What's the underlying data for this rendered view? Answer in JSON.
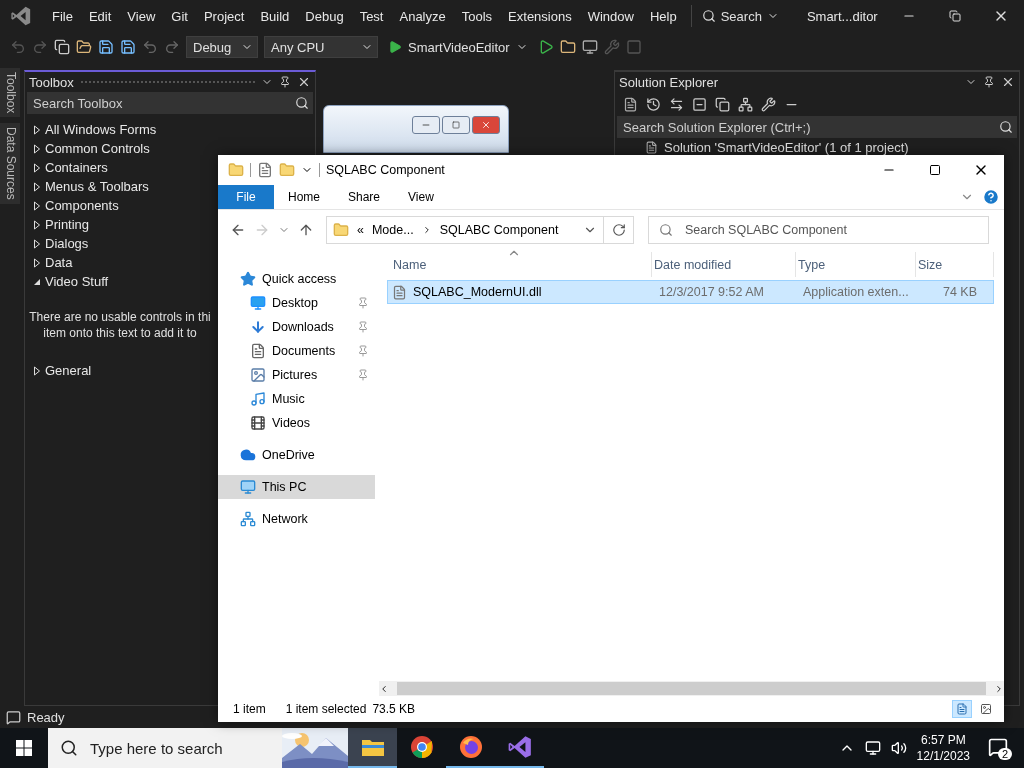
{
  "ide": {
    "menu": [
      "File",
      "Edit",
      "View",
      "Git",
      "Project",
      "Build",
      "Debug",
      "Test",
      "Analyze",
      "Tools",
      "Extensions",
      "Window",
      "Help"
    ],
    "search": "Search",
    "title": "Smart...ditor",
    "toolbar": {
      "configuration": "Debug",
      "platform": "Any CPU",
      "start_target": "SmartVideoEditor"
    },
    "side_tabs": [
      "Toolbox",
      "Data Sources"
    ],
    "toolbox": {
      "title": "Toolbox",
      "search_placeholder": "Search Toolbox",
      "groups": [
        {
          "label": "All Windows Forms",
          "expanded": false
        },
        {
          "label": "Common Controls",
          "expanded": false
        },
        {
          "label": "Containers",
          "expanded": false
        },
        {
          "label": "Menus & Toolbars",
          "expanded": false
        },
        {
          "label": "Components",
          "expanded": false
        },
        {
          "label": "Printing",
          "expanded": false
        },
        {
          "label": "Dialogs",
          "expanded": false
        },
        {
          "label": "Data",
          "expanded": false
        },
        {
          "label": "Video Stuff",
          "expanded": true,
          "empty_message": [
            "There are no usable controls in thi",
            "item onto this text to add it to"
          ]
        },
        {
          "label": "General",
          "expanded": false
        }
      ]
    },
    "solution_explorer": {
      "title": "Solution Explorer",
      "search_placeholder": "Search Solution Explorer (Ctrl+;)",
      "root": "Solution 'SmartVideoEditor' (1 of 1 project)"
    },
    "status": "Ready"
  },
  "explorer": {
    "title": "SQLABC Component",
    "ribbon_tabs": [
      {
        "label": "File",
        "selected": true
      },
      {
        "label": "Home",
        "selected": false
      },
      {
        "label": "Share",
        "selected": false
      },
      {
        "label": "View",
        "selected": false
      }
    ],
    "address": {
      "overflow": "«",
      "crumbs": [
        "Mode...",
        "SQLABC Component"
      ]
    },
    "search_placeholder": "Search SQLABC Component",
    "nav": [
      {
        "label": "Quick access",
        "kind": "quick_access",
        "selected": false,
        "children": [
          {
            "label": "Desktop",
            "kind": "desktop",
            "selected": false,
            "pinned": true
          },
          {
            "label": "Downloads",
            "kind": "downloads",
            "selected": false,
            "pinned": true
          },
          {
            "label": "Documents",
            "kind": "documents",
            "selected": false,
            "pinned": true
          },
          {
            "label": "Pictures",
            "kind": "pictures",
            "selected": false,
            "pinned": true
          },
          {
            "label": "Music",
            "kind": "music",
            "selected": false,
            "pinned": false
          },
          {
            "label": "Videos",
            "kind": "videos",
            "selected": false,
            "pinned": false
          }
        ]
      },
      {
        "label": "OneDrive",
        "kind": "onedrive",
        "selected": false
      },
      {
        "label": "This PC",
        "kind": "this_pc",
        "selected": true
      },
      {
        "label": "Network",
        "kind": "network",
        "selected": false
      }
    ],
    "columns": [
      "Name",
      "Date modified",
      "Type",
      "Size"
    ],
    "files": [
      {
        "name": "SQLABC_ModernUI.dll",
        "date": "12/3/2017 9:52 AM",
        "type": "Application exten...",
        "size": "74 KB",
        "selected": true
      }
    ],
    "status": {
      "count": "1 item",
      "selection": "1 item selected",
      "size": "73.5 KB"
    }
  },
  "taskbar": {
    "search_placeholder": "Type here to search",
    "apps": [
      {
        "kind": "explorer",
        "active": true,
        "running": true
      },
      {
        "kind": "chrome",
        "active": false,
        "running": false
      },
      {
        "kind": "firefox",
        "active": false,
        "running": true
      },
      {
        "kind": "visual_studio",
        "active": false,
        "running": true
      }
    ],
    "time": "6:57 PM",
    "date": "12/1/2023",
    "notifications": "2"
  }
}
